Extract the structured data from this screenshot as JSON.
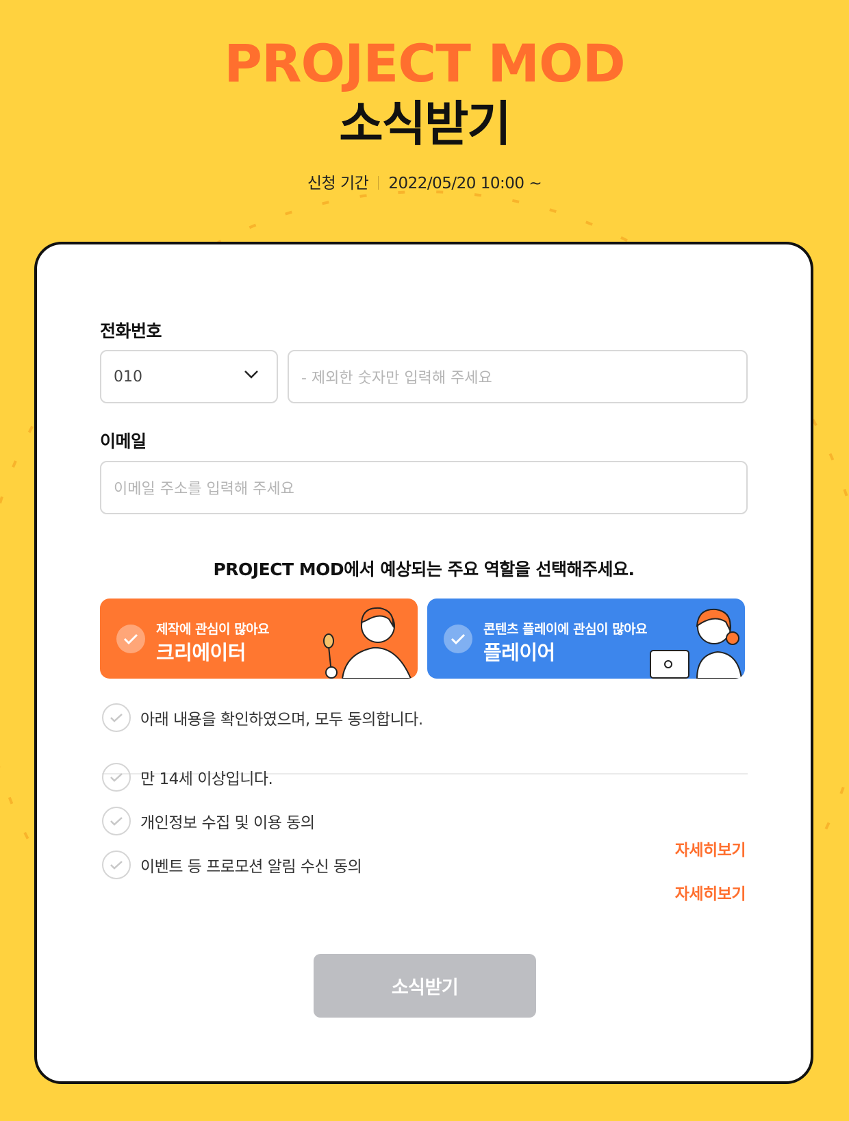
{
  "colors": {
    "background": "#FFD23F",
    "brand": "#FF6F2E",
    "creator": "#FF7730",
    "player": "#3D86EC",
    "submit_disabled": "#BDBEC2"
  },
  "header": {
    "brand": "PROJECT MOD",
    "title": "소식받기",
    "period_label": "신청 기간",
    "period_value": "2022/05/20 10:00 ~"
  },
  "form": {
    "phone": {
      "label": "전화번호",
      "prefix_selected": "010",
      "placeholder": "- 제외한 숫자만 입력해 주세요"
    },
    "email": {
      "label": "이메일",
      "placeholder": "이메일 주소를 입력해 주세요"
    },
    "role_question": "PROJECT MOD에서 예상되는 주요 역할을 선택해주세요.",
    "roles": [
      {
        "sub": "제작에 관심이 많아요",
        "name": "크리에이터",
        "icon": "check-icon"
      },
      {
        "sub": "콘텐츠 플레이에 관심이 많아요",
        "name": "플레이어",
        "icon": "check-icon"
      }
    ],
    "agree_all": "아래 내용을 확인하였으며, 모두 동의합니다.",
    "agreements": [
      {
        "text": "만 14세 이상입니다.",
        "more": ""
      },
      {
        "text": "개인정보 수집 및 이용 동의",
        "more": "자세히보기"
      },
      {
        "text": "이벤트 등 프로모션 알림 수신 동의",
        "more": "자세히보기"
      }
    ],
    "submit_label": "소식받기"
  }
}
